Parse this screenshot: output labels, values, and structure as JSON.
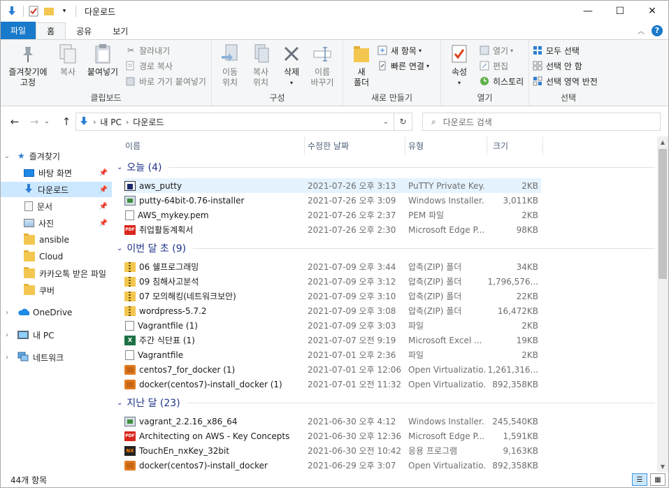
{
  "window": {
    "title": "다운로드"
  },
  "tabs": {
    "file": "파일",
    "home": "홈",
    "share": "공유",
    "view": "보기"
  },
  "ribbon": {
    "clipboard": {
      "label": "클립보드",
      "pin": "즐겨찾기에\n고정",
      "pin_l1": "즐겨찾기에",
      "pin_l2": "고정",
      "copy": "복사",
      "paste": "붙여넣기",
      "cut": "잘라내기",
      "copy_path": "경로 복사",
      "paste_shortcut": "바로 가기 붙여넣기"
    },
    "organize": {
      "label": "구성",
      "move_l1": "이동",
      "move_l2": "위치",
      "copy_l1": "복사",
      "copy_l2": "위치",
      "delete": "삭제",
      "rename_l1": "이름",
      "rename_l2": "바꾸기"
    },
    "new": {
      "label": "새로 만들기",
      "new_folder_l1": "새",
      "new_folder_l2": "폴더",
      "new_item": "새 항목",
      "easy_access": "빠른 연결"
    },
    "open": {
      "label": "열기",
      "properties": "속성",
      "open": "열기",
      "edit": "편집",
      "history": "히스토리"
    },
    "select": {
      "label": "선택",
      "select_all": "모두 선택",
      "select_none": "선택 안 함",
      "invert": "선택 영역 반전"
    }
  },
  "address": {
    "root": "내 PC",
    "current": "다운로드",
    "search_placeholder": "다운로드 검색"
  },
  "nav": {
    "quick_access": "즐겨찾기",
    "items": [
      {
        "label": "바탕 화면",
        "icon": "desktop-icon",
        "pinned": true
      },
      {
        "label": "다운로드",
        "icon": "download-icon",
        "pinned": true,
        "selected": true
      },
      {
        "label": "문서",
        "icon": "document-icon",
        "pinned": true
      },
      {
        "label": "사진",
        "icon": "picture-icon",
        "pinned": true
      },
      {
        "label": "ansible",
        "icon": "folder-icon"
      },
      {
        "label": "Cloud",
        "icon": "folder-icon"
      },
      {
        "label": "카카오톡 받은 파일",
        "icon": "folder-icon"
      },
      {
        "label": "쿠버",
        "icon": "folder-icon"
      }
    ],
    "onedrive": "OneDrive",
    "this_pc": "내 PC",
    "network": "네트워크"
  },
  "columns": {
    "name": "이름",
    "date": "수정한 날짜",
    "type": "유형",
    "size": "크기"
  },
  "groups": [
    {
      "title": "오늘 (4)",
      "rows": [
        {
          "name": "aws_putty",
          "date": "2021-07-26 오후 3:13",
          "type": "PuTTY Private Key...",
          "size": "2KB",
          "icon": "ppk",
          "selected": true
        },
        {
          "name": "putty-64bit-0.76-installer",
          "date": "2021-07-26 오후 3:09",
          "type": "Windows Installer...",
          "size": "3,011KB",
          "icon": "msi"
        },
        {
          "name": "AWS_mykey.pem",
          "date": "2021-07-26 오후 2:37",
          "type": "PEM 파일",
          "size": "2KB",
          "icon": "doc"
        },
        {
          "name": "취업활동계획서",
          "date": "2021-07-26 오후 2:30",
          "type": "Microsoft Edge P...",
          "size": "98KB",
          "icon": "pdf"
        }
      ]
    },
    {
      "title": "이번 달 초 (9)",
      "rows": [
        {
          "name": "06 쉘프로그래밍",
          "date": "2021-07-09 오후 3:44",
          "type": "압축(ZIP) 폴더",
          "size": "34KB",
          "icon": "zip"
        },
        {
          "name": "09 침해사고분석",
          "date": "2021-07-09 오후 3:12",
          "type": "압축(ZIP) 폴더",
          "size": "1,796,576...",
          "icon": "zip"
        },
        {
          "name": "07 모의해킹(네트워크보안)",
          "date": "2021-07-09 오후 3:10",
          "type": "압축(ZIP) 폴더",
          "size": "22KB",
          "icon": "zip"
        },
        {
          "name": "wordpress-5.7.2",
          "date": "2021-07-09 오후 3:08",
          "type": "압축(ZIP) 폴더",
          "size": "16,472KB",
          "icon": "zip"
        },
        {
          "name": "Vagrantfile (1)",
          "date": "2021-07-09 오후 3:03",
          "type": "파일",
          "size": "2KB",
          "icon": "doc"
        },
        {
          "name": "주간 식단표 (1)",
          "date": "2021-07-07 오전 9:19",
          "type": "Microsoft Excel ...",
          "size": "19KB",
          "icon": "xls"
        },
        {
          "name": "Vagrantfile",
          "date": "2021-07-01 오후 2:36",
          "type": "파일",
          "size": "2KB",
          "icon": "doc"
        },
        {
          "name": "centos7_for_docker (1)",
          "date": "2021-07-01 오후 12:06",
          "type": "Open Virtualizatio...",
          "size": "1,261,316...",
          "icon": "box"
        },
        {
          "name": "docker(centos7)-install_docker (1)",
          "date": "2021-07-01 오전 11:32",
          "type": "Open Virtualizatio...",
          "size": "892,358KB",
          "icon": "box"
        }
      ]
    },
    {
      "title": "지난 달 (23)",
      "rows": [
        {
          "name": "vagrant_2.2.16_x86_64",
          "date": "2021-06-30 오후 4:12",
          "type": "Windows Installer...",
          "size": "245,540KB",
          "icon": "msi"
        },
        {
          "name": "Architecting on AWS - Key Concepts",
          "date": "2021-06-30 오후 12:36",
          "type": "Microsoft Edge P...",
          "size": "1,591KB",
          "icon": "pdf"
        },
        {
          "name": "TouchEn_nxKey_32bit",
          "date": "2021-06-30 오전 10:42",
          "type": "응용 프로그램",
          "size": "9,163KB",
          "icon": "exe"
        },
        {
          "name": "docker(centos7)-install_docker",
          "date": "2021-06-29 오후 3:07",
          "type": "Open Virtualizatio...",
          "size": "892,358KB",
          "icon": "box"
        }
      ]
    }
  ],
  "status": {
    "count": "44개 항목"
  }
}
